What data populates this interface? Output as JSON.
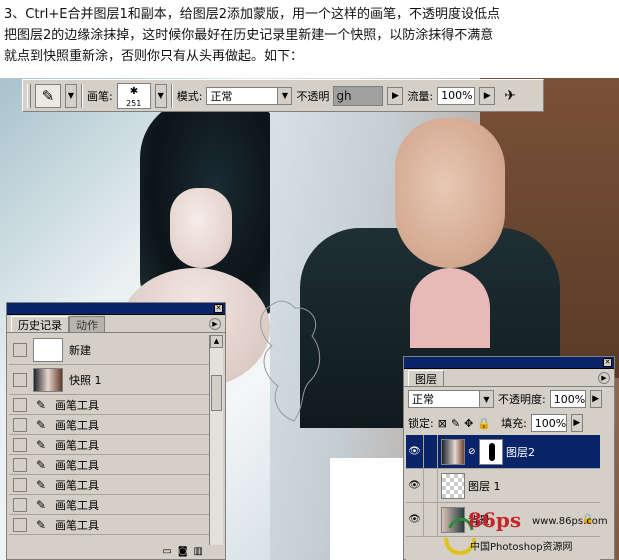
{
  "caption": {
    "lines": [
      "3、Ctrl+E合并图层1和副本，给图层2添加蒙版，用一个这样的画笔，不透明度设低点",
      "把图层2的边缘涂抹掉，这时候你最好在历史记录里新建一个快照，以防涂抹得不满意",
      "就点到快照重新涂，否则你只有从头再做起。如下："
    ]
  },
  "options_bar": {
    "brush_label": "画笔:",
    "brush_size": "251",
    "mode_label": "模式:",
    "mode_value": "正常",
    "opacity_label": "不透明",
    "opacity_value": "gh",
    "flow_label": "流量:",
    "flow_value": "100%"
  },
  "history": {
    "tabs": [
      "历史记录",
      "动作"
    ],
    "rows": [
      {
        "label": "新建",
        "type": "new"
      },
      {
        "label": "快照 1",
        "type": "snapshot"
      },
      {
        "label": "画笔工具",
        "type": "brush"
      },
      {
        "label": "画笔工具",
        "type": "brush"
      },
      {
        "label": "画笔工具",
        "type": "brush"
      },
      {
        "label": "画笔工具",
        "type": "brush"
      },
      {
        "label": "画笔工具",
        "type": "brush"
      },
      {
        "label": "画笔工具",
        "type": "brush"
      },
      {
        "label": "画笔工具",
        "type": "brush"
      }
    ]
  },
  "layers": {
    "tab": "图层",
    "blend_mode": "正常",
    "opacity_label": "不透明度:",
    "opacity_value": "100%",
    "lock_label": "锁定:",
    "fill_label": "填充:",
    "fill_value": "100%",
    "rows": [
      {
        "name": "图层2",
        "selected": true
      },
      {
        "name": "图层 1",
        "selected": false
      },
      {
        "name": "背景",
        "selected": false
      }
    ]
  },
  "watermark": {
    "logo": "86ps",
    "url": "www.86ps.com",
    "cn": "中国Photoshop资源网"
  },
  "icons": {
    "brush": "brush-icon",
    "eye": "eye-icon",
    "lock": "lock-icon",
    "link": "link-icon",
    "airbrush": "airbrush-icon"
  }
}
